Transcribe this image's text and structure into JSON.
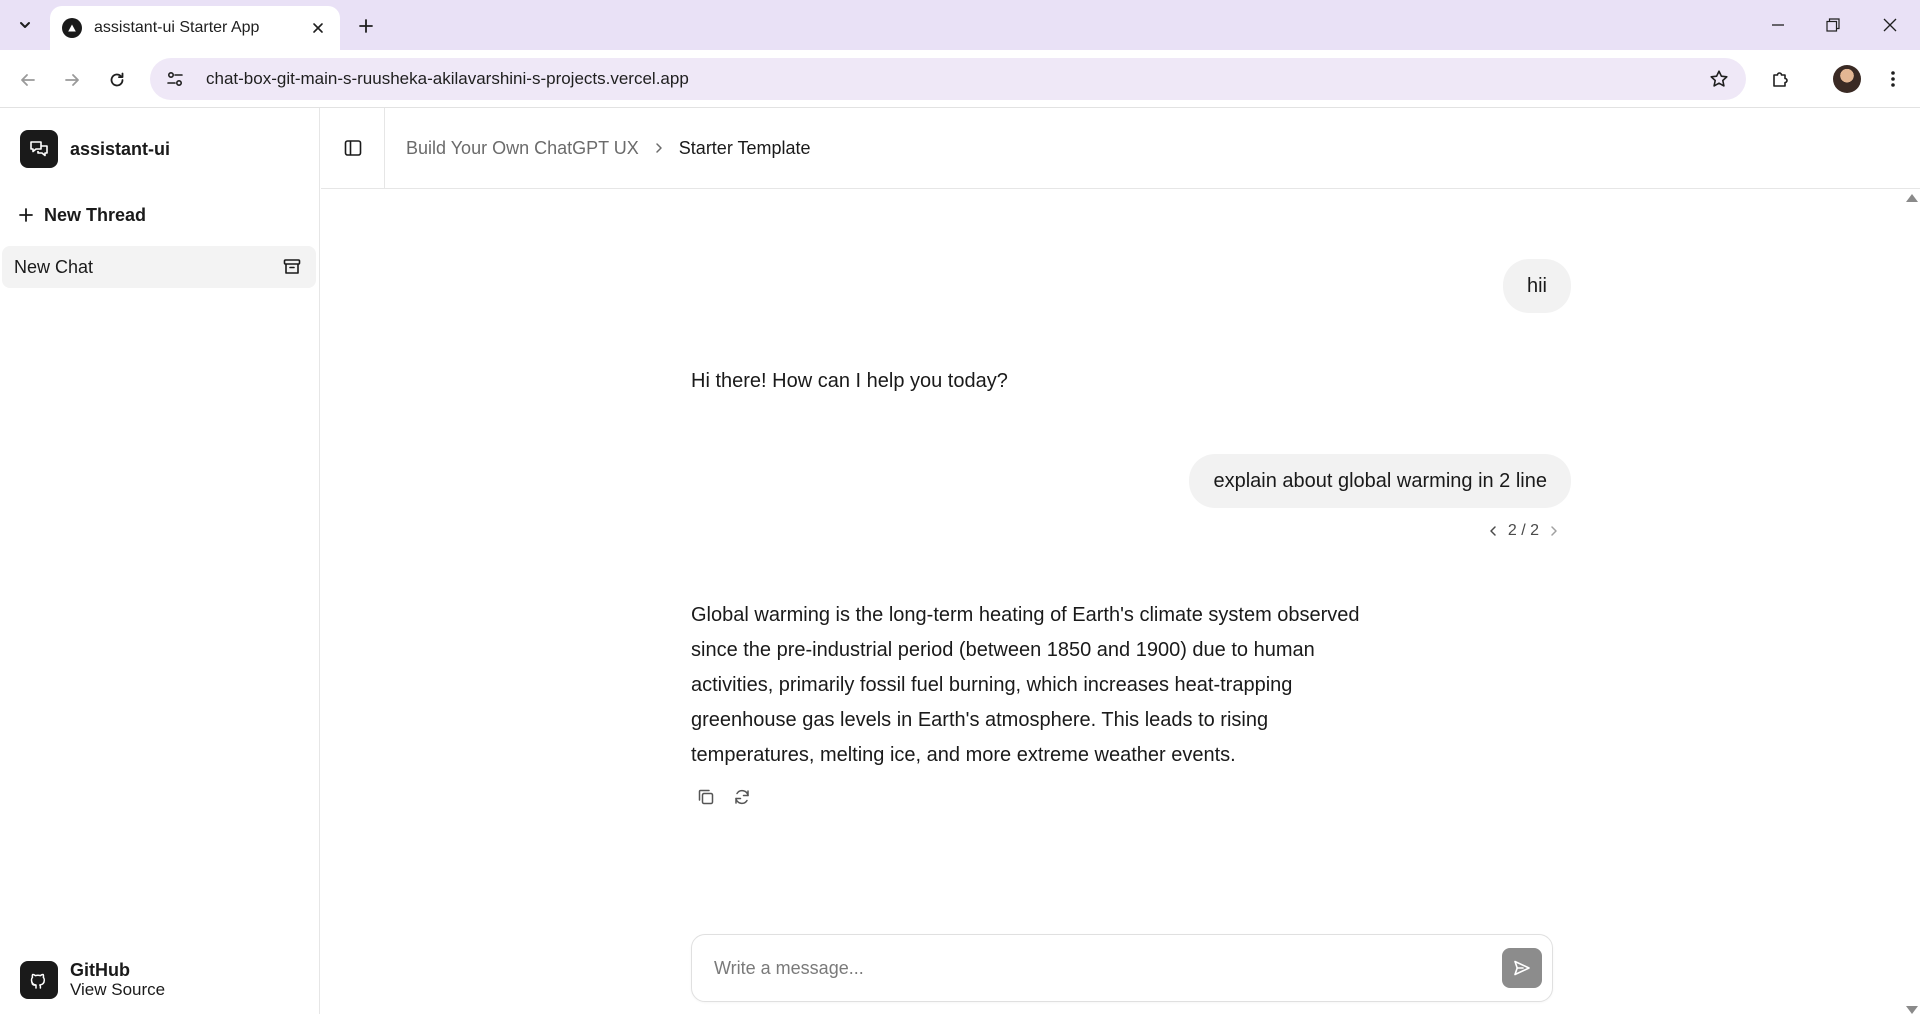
{
  "browser": {
    "tab_title": "assistant-ui Starter App",
    "url": "chat-box-git-main-s-ruusheka-akilavarshini-s-projects.vercel.app"
  },
  "sidebar": {
    "brand_name": "assistant-ui",
    "new_thread_label": "New Thread",
    "threads": [
      {
        "label": "New Chat"
      }
    ],
    "github": {
      "title": "GitHub",
      "subtitle": "View Source"
    }
  },
  "header": {
    "breadcrumb": [
      "Build Your Own ChatGPT UX",
      "Starter Template"
    ]
  },
  "thread": {
    "messages": [
      {
        "role": "user",
        "text": "hii"
      },
      {
        "role": "assistant",
        "text": "Hi there! How can I help you today?"
      },
      {
        "role": "user",
        "text": "explain about global warming in 2 line",
        "branch": "2 / 2"
      },
      {
        "role": "assistant",
        "text": "Global warming is the long-term heating of Earth's climate system observed since the pre-industrial period (between 1850 and 1900) due to human activities, primarily fossil fuel burning, which increases heat-trapping greenhouse gas levels in Earth's atmosphere. This leads to rising temperatures, melting ice, and more extreme weather events."
      }
    ]
  },
  "composer": {
    "placeholder": "Write a message..."
  },
  "colors": {
    "tabbar": "#e9e1f6",
    "omnibox": "#efe8f7",
    "bubble": "#f2f2f2",
    "send": "#8c8c8c",
    "brand": "#1a1a1a"
  }
}
